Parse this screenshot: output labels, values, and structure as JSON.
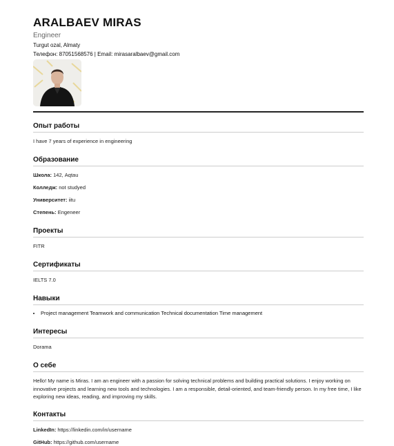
{
  "header": {
    "name": "ARALBAEV MIRAS",
    "title": "Engineer",
    "address": "Turgut ozal, Almaty",
    "contact_line": "Телефон: 87051568576 | Email: mirasaralbaev@gmail.com"
  },
  "sections": {
    "experience": {
      "title": "Опыт работы",
      "text": "I have 7 years of experience in engineering"
    },
    "education": {
      "title": "Образование",
      "school_label": "Школа:",
      "school_value": " 142, Aqtau",
      "college_label": "Колледж:",
      "college_value": " not studyed",
      "university_label": "Университет:",
      "university_value": " iitu",
      "degree_label": "Степень:",
      "degree_value": " Engeneer"
    },
    "projects": {
      "title": "Проекты",
      "text": "FITR"
    },
    "certificates": {
      "title": "Сертификаты",
      "text": "IELTS 7.0"
    },
    "skills": {
      "title": "Навыки",
      "item": "Project management Teamwork and communication Technical documentation Time management"
    },
    "interests": {
      "title": "Интересы",
      "text": "Dorama"
    },
    "about": {
      "title": "О себе",
      "text": "Hello! My name is Miras. I am an engineer with a passion for solving technical problems and building practical solutions. I enjoy working on innovative projects and learning new tools and technologies. I am a responsible, detail-oriented, and team-friendly person. In my free time, I like exploring new ideas, reading, and improving my skills."
    },
    "contacts": {
      "title": "Контакты",
      "linkedin_label": "LinkedIn:",
      "linkedin_value": " https://linkedin.com/in/username",
      "github_label": "GitHub:",
      "github_value": " https://github.com/username"
    }
  }
}
